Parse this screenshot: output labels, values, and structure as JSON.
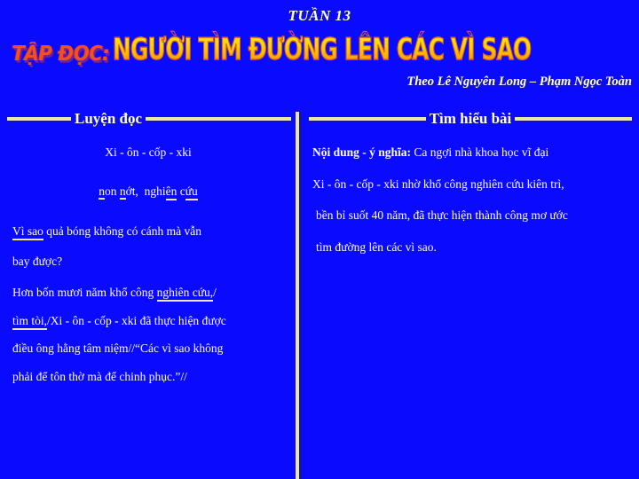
{
  "slide": {
    "week_title": "TUẦN 13",
    "background_color": "#0a0aff",
    "accent_color": "#ece8a2",
    "text_color": "#ffffff"
  },
  "wordart": {
    "prefix": "TẬP ĐỌC:",
    "prefix_color": "#f4511a",
    "prefix_shadow_color": "#7a1fa0",
    "title": "NGƯỜI TÌM ĐƯỜNG LÊN CÁC VÌ SAO",
    "title_fill_top": "#ffe21f",
    "title_fill_bottom": "#ff8c00",
    "title_outline": "#e0531c"
  },
  "credit": "Theo Lê Nguyên Long – Phạm Ngọc Toàn",
  "sections": {
    "left_heading": "Luyện đọc",
    "right_heading": "Tìm hiểu  bài"
  },
  "left_column": {
    "pronunciation": "Xi - ôn - cốp - xki",
    "words": {
      "w1_u": "n",
      "w1_rest": "on ",
      "w2_u": "n",
      "w2_rest": "ớt,",
      "w3_pre": "nghi",
      "w3_u": "ên",
      "w4_pre": "c",
      "w4_u": "ứu"
    },
    "q_line1_u": "Vì sao",
    "q_line1_rest": " quả bóng không có cánh mà vẫn",
    "q_line2": "bay được?",
    "p_line1_pre": "Hơn bốn mươi năm khổ công ",
    "p_line1_u": "nghiên cứu,",
    "p_line1_slash": "/",
    "p_line2_u": "tìm  tòi,",
    "p_line2_slash": "/",
    "p_line2_rest": "Xi - ôn - cốp - xki đã thực hiện được",
    "p_line3_pre": "điều  ông hằng tâm niệm",
    "p_line3_slash": "//",
    "p_line3_rest": "“Các vì sao không",
    "p_line4": "phải để  tôn thờ mà để chinh phục.”",
    "p_line4_slash": "//"
  },
  "right_column": {
    "label": "Nội dung - ý nghĩa:",
    "body_line1": " Ca ngợi nhà khoa học vĩ đại",
    "body_line2": "Xi - ôn - cốp - xki nhờ khổ công nghiên cứu kiên trì,",
    "body_line3": "bền bỉ suốt 40 năm, đã thực hiện thành công mơ ước",
    "body_line4": "tìm đường lên các vì sao."
  }
}
